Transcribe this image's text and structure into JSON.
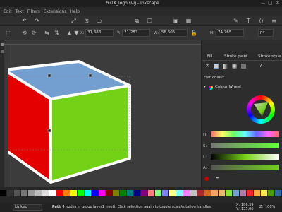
{
  "window": {
    "title": "*GTK_logo.svg - Inkscape"
  },
  "menu": [
    "Edit",
    "Text",
    "Filters",
    "Extensions",
    "Help"
  ],
  "controls": {
    "x_label": "X:",
    "x_value": "31,383",
    "y_label": "Y:",
    "y_value": "21,283",
    "w_label": "W:",
    "w_value": "58,605",
    "h_label": "H:",
    "h_value": "74,765",
    "unit": "px"
  },
  "panel": {
    "tabs": [
      "Fill",
      "Stroke paint",
      "Stroke style"
    ],
    "flat_colour_label": "Flat colour",
    "wheel_label": "Colour Wheel",
    "channel_labels": [
      "H:",
      "S:",
      "L:",
      "A:"
    ]
  },
  "cube_colors": {
    "top": "#729fcf",
    "left": "#e50000",
    "front": "#73d216",
    "outline": "#ffffff"
  },
  "palette": [
    "#000000",
    "#333333",
    "#555555",
    "#777777",
    "#999999",
    "#bbbbbb",
    "#dddddd",
    "#ffffff",
    "#ff0000",
    "#ff7f00",
    "#ffff00",
    "#00ff00",
    "#00ffff",
    "#0000ff",
    "#ff00ff",
    "#800000",
    "#808000",
    "#008000",
    "#008080",
    "#000080",
    "#800080",
    "#ff8080",
    "#80ff80",
    "#8080ff",
    "#ffff80",
    "#80ffff",
    "#ff80ff",
    "#c0c0c0",
    "#a52a2a",
    "#d2691e",
    "#f4a460",
    "#e9b96e",
    "#8ae234",
    "#729fcf",
    "#ad7fa8",
    "#ef2929",
    "#fcaf3e",
    "#fce94f",
    "#4e9a06",
    "#3465a4"
  ],
  "status": {
    "layer": "Linked",
    "message_bold": "Path",
    "message": " 4 nodes in group layer1 (root). Click selection again to toggle scale/rotation handles.",
    "x_label": "X:",
    "x_value": "186,39",
    "y_label": "Y:",
    "y_value": "135,00",
    "z_label": "Z:",
    "zoom": "100%"
  }
}
